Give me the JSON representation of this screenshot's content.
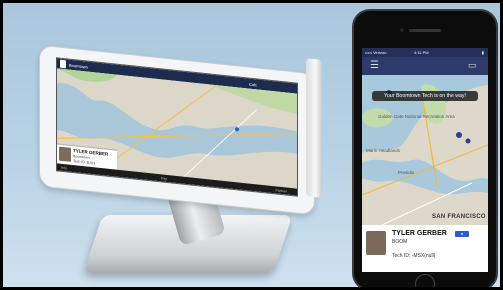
{
  "tablet": {
    "brand": "Boomtown",
    "eta_label": "Calc",
    "call_label": "",
    "tech": {
      "name": "TYLER GERBER",
      "company": "Boomtown",
      "tech_id": "Tech ID: BJX3"
    },
    "nav": {
      "left": "Info",
      "center": "Pay",
      "right": "Partner"
    }
  },
  "phone": {
    "status": {
      "carrier": "••••• Verizon",
      "time": "4:11 PM"
    },
    "toast": "Your Boomtown Tech is on the way!",
    "tech": {
      "name": "TYLER GERBER",
      "badge": "●",
      "company": "BOOM",
      "tech_id": "Tech ID: -MSX(null)"
    },
    "map": {
      "city_label": "SAN FRANCISCO",
      "labels": [
        "Golden Gate National Recreation Area",
        "Presidio",
        "Marin Headlands"
      ]
    }
  }
}
